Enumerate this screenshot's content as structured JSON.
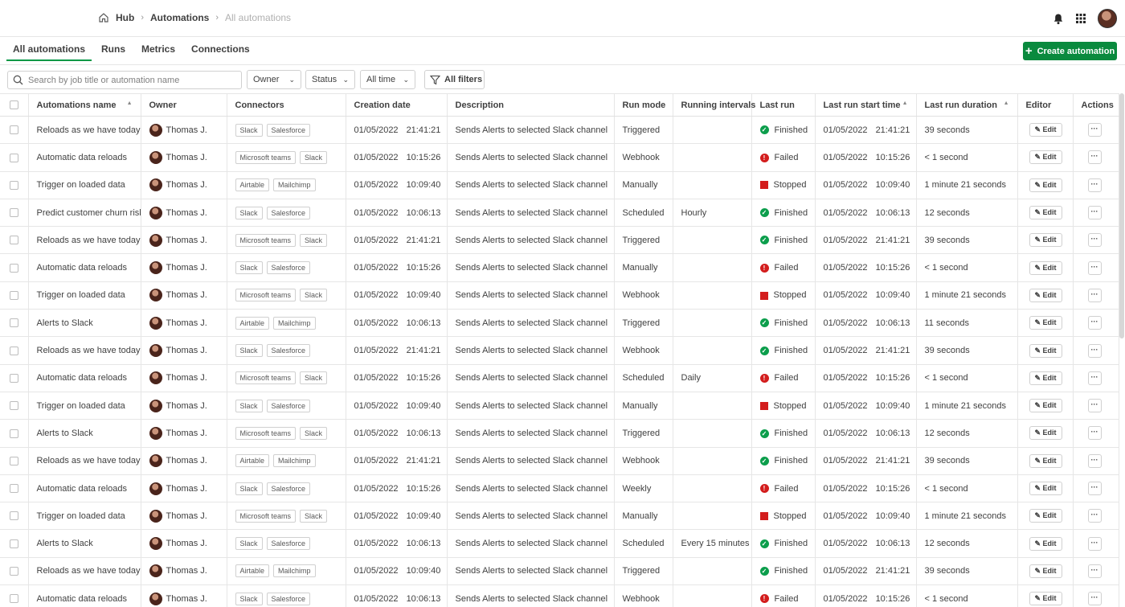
{
  "breadcrumb": [
    "Hub",
    "Automations",
    "All automations"
  ],
  "tabs": [
    "All automations",
    "Runs",
    "Metrics",
    "Connections"
  ],
  "create_button": "Create automation",
  "search": {
    "placeholder": "Search by job title or automation name"
  },
  "filters": {
    "owner": "Owner",
    "status": "Status",
    "time": "All time",
    "all_filters": "All filters"
  },
  "columns": [
    "Automations name",
    "Owner",
    "Connectors",
    "Creation date",
    "Description",
    "Run mode",
    "Running intervals",
    "Last run",
    "Last run start time",
    "Last run duration",
    "Editor",
    "Actions"
  ],
  "edit_label": "Edit",
  "more_label": "···",
  "rows": [
    {
      "name": "Reloads as we have today",
      "owner": "Thomas J.",
      "connectors": [
        "Slack",
        "Salesforce"
      ],
      "created_date": "01/05/2022",
      "created_time": "21:41:21",
      "description": "Sends Alerts to selected Slack channel",
      "run_mode": "Triggered",
      "interval": "",
      "status": "Finished",
      "start_date": "01/05/2022",
      "start_time": "21:41:21",
      "duration": "39 seconds"
    },
    {
      "name": "Automatic data reloads",
      "owner": "Thomas J.",
      "connectors": [
        "Microsoft teams",
        "Slack"
      ],
      "created_date": "01/05/2022",
      "created_time": "10:15:26",
      "description": "Sends Alerts to selected Slack channel",
      "run_mode": "Webhook",
      "interval": "",
      "status": "Failed",
      "start_date": "01/05/2022",
      "start_time": "10:15:26",
      "duration": "< 1 second"
    },
    {
      "name": "Trigger on loaded data",
      "owner": "Thomas J.",
      "connectors": [
        "Airtable",
        "Mailchimp"
      ],
      "created_date": "01/05/2022",
      "created_time": "10:09:40",
      "description": "Sends Alerts to selected Slack channel",
      "run_mode": "Manually",
      "interval": "",
      "status": "Stopped",
      "start_date": "01/05/2022",
      "start_time": "10:09:40",
      "duration": "1 minute 21 seconds"
    },
    {
      "name": "Predict customer churn risk",
      "owner": "Thomas J.",
      "connectors": [
        "Slack",
        "Salesforce"
      ],
      "created_date": "01/05/2022",
      "created_time": "10:06:13",
      "description": "Sends Alerts to selected Slack channel",
      "run_mode": "Scheduled",
      "interval": "Hourly",
      "status": "Finished",
      "start_date": "01/05/2022",
      "start_time": "10:06:13",
      "duration": "12 seconds"
    },
    {
      "name": "Reloads as we have today",
      "owner": "Thomas J.",
      "connectors": [
        "Microsoft teams",
        "Slack"
      ],
      "created_date": "01/05/2022",
      "created_time": "21:41:21",
      "description": "Sends Alerts to selected Slack channel",
      "run_mode": "Triggered",
      "interval": "",
      "status": "Finished",
      "start_date": "01/05/2022",
      "start_time": "21:41:21",
      "duration": "39 seconds"
    },
    {
      "name": "Automatic data reloads",
      "owner": "Thomas J.",
      "connectors": [
        "Slack",
        "Salesforce"
      ],
      "created_date": "01/05/2022",
      "created_time": "10:15:26",
      "description": "Sends Alerts to selected Slack channel",
      "run_mode": "Manually",
      "interval": "",
      "status": "Failed",
      "start_date": "01/05/2022",
      "start_time": "10:15:26",
      "duration": "< 1 second"
    },
    {
      "name": "Trigger on loaded data",
      "owner": "Thomas J.",
      "connectors": [
        "Microsoft teams",
        "Slack"
      ],
      "created_date": "01/05/2022",
      "created_time": "10:09:40",
      "description": "Sends Alerts to selected Slack channel",
      "run_mode": "Webhook",
      "interval": "",
      "status": "Stopped",
      "start_date": "01/05/2022",
      "start_time": "10:09:40",
      "duration": "1 minute 21 seconds"
    },
    {
      "name": "Alerts to Slack",
      "owner": "Thomas J.",
      "connectors": [
        "Airtable",
        "Mailchimp"
      ],
      "created_date": "01/05/2022",
      "created_time": "10:06:13",
      "description": "Sends Alerts to selected Slack channel",
      "run_mode": "Triggered",
      "interval": "",
      "status": "Finished",
      "start_date": "01/05/2022",
      "start_time": "10:06:13",
      "duration": "11 seconds"
    },
    {
      "name": "Reloads as we have today",
      "owner": "Thomas J.",
      "connectors": [
        "Slack",
        "Salesforce"
      ],
      "created_date": "01/05/2022",
      "created_time": "21:41:21",
      "description": "Sends Alerts to selected Slack channel",
      "run_mode": "Webhook",
      "interval": "",
      "status": "Finished",
      "start_date": "01/05/2022",
      "start_time": "21:41:21",
      "duration": "39 seconds"
    },
    {
      "name": "Automatic data reloads",
      "owner": "Thomas J.",
      "connectors": [
        "Microsoft teams",
        "Slack"
      ],
      "created_date": "01/05/2022",
      "created_time": "10:15:26",
      "description": "Sends Alerts to selected Slack channel",
      "run_mode": "Scheduled",
      "interval": "Daily",
      "status": "Failed",
      "start_date": "01/05/2022",
      "start_time": "10:15:26",
      "duration": "< 1 second"
    },
    {
      "name": "Trigger on loaded data",
      "owner": "Thomas J.",
      "connectors": [
        "Slack",
        "Salesforce"
      ],
      "created_date": "01/05/2022",
      "created_time": "10:09:40",
      "description": "Sends Alerts to selected Slack channel",
      "run_mode": "Manually",
      "interval": "",
      "status": "Stopped",
      "start_date": "01/05/2022",
      "start_time": "10:09:40",
      "duration": "1 minute 21 seconds"
    },
    {
      "name": "Alerts to Slack",
      "owner": "Thomas J.",
      "connectors": [
        "Microsoft teams",
        "Slack"
      ],
      "created_date": "01/05/2022",
      "created_time": "10:06:13",
      "description": "Sends Alerts to selected Slack channel",
      "run_mode": "Triggered",
      "interval": "",
      "status": "Finished",
      "start_date": "01/05/2022",
      "start_time": "10:06:13",
      "duration": "12 seconds"
    },
    {
      "name": "Reloads as we have today",
      "owner": "Thomas J.",
      "connectors": [
        "Airtable",
        "Mailchimp"
      ],
      "created_date": "01/05/2022",
      "created_time": "21:41:21",
      "description": "Sends Alerts to selected Slack channel",
      "run_mode": "Webhook",
      "interval": "",
      "status": "Finished",
      "start_date": "01/05/2022",
      "start_time": "21:41:21",
      "duration": "39 seconds"
    },
    {
      "name": "Automatic data reloads",
      "owner": "Thomas J.",
      "connectors": [
        "Slack",
        "Salesforce"
      ],
      "created_date": "01/05/2022",
      "created_time": "10:15:26",
      "description": "Sends Alerts to selected Slack channel",
      "run_mode": "Weekly",
      "interval": "",
      "status": "Failed",
      "start_date": "01/05/2022",
      "start_time": "10:15:26",
      "duration": "< 1 second"
    },
    {
      "name": "Trigger on loaded data",
      "owner": "Thomas J.",
      "connectors": [
        "Microsoft teams",
        "Slack"
      ],
      "created_date": "01/05/2022",
      "created_time": "10:09:40",
      "description": "Sends Alerts to selected Slack channel",
      "run_mode": "Manually",
      "interval": "",
      "status": "Stopped",
      "start_date": "01/05/2022",
      "start_time": "10:09:40",
      "duration": "1 minute 21 seconds"
    },
    {
      "name": "Alerts to Slack",
      "owner": "Thomas J.",
      "connectors": [
        "Slack",
        "Salesforce"
      ],
      "created_date": "01/05/2022",
      "created_time": "10:06:13",
      "description": "Sends Alerts to selected Slack channel",
      "run_mode": "Scheduled",
      "interval": "Every 15 minutes",
      "status": "Finished",
      "start_date": "01/05/2022",
      "start_time": "10:06:13",
      "duration": "12 seconds"
    },
    {
      "name": "Reloads as we have today",
      "owner": "Thomas J.",
      "connectors": [
        "Airtable",
        "Mailchimp"
      ],
      "created_date": "01/05/2022",
      "created_time": "10:09:40",
      "description": "Sends Alerts to selected Slack channel",
      "run_mode": "Triggered",
      "interval": "",
      "status": "Finished",
      "start_date": "01/05/2022",
      "start_time": "21:41:21",
      "duration": "39 seconds"
    },
    {
      "name": "Automatic data reloads",
      "owner": "Thomas J.",
      "connectors": [
        "Slack",
        "Salesforce"
      ],
      "created_date": "01/05/2022",
      "created_time": "10:06:13",
      "description": "Sends Alerts to selected Slack channel",
      "run_mode": "Webhook",
      "interval": "",
      "status": "Failed",
      "start_date": "01/05/2022",
      "start_time": "10:15:26",
      "duration": "< 1 second"
    }
  ],
  "colors": {
    "accent": "#009845",
    "button": "#0a8a3e",
    "finished": "#0c9e4c",
    "failed": "#d31d1d",
    "stopped": "#d31d1d"
  }
}
